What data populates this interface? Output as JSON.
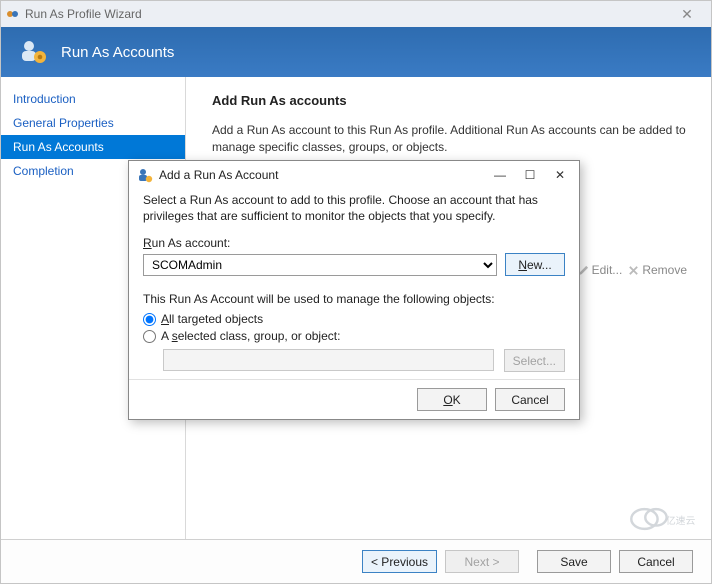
{
  "window": {
    "title": "Run As Profile Wizard"
  },
  "banner": {
    "title": "Run As Accounts"
  },
  "sidebar": {
    "items": [
      {
        "label": "Introduction"
      },
      {
        "label": "General Properties"
      },
      {
        "label": "Run As Accounts"
      },
      {
        "label": "Completion"
      }
    ]
  },
  "main": {
    "heading": "Add Run As accounts",
    "desc": "Add a Run As account to this Run As profile.  Additional Run As accounts can be added to manage specific classes, groups, or objects.",
    "actions": {
      "edit": "Edit...",
      "remove": "Remove"
    }
  },
  "modal": {
    "title": "Add a Run As Account",
    "instr": "Select a Run As account to add to this profile.  Choose an account that has privileges that are sufficient to monitor the objects that you specify.",
    "account_label": "Run As account:",
    "account_value": "SCOMAdmin",
    "new_btn": "New...",
    "used_for": "This Run As Account will be used to manage the following objects:",
    "radio_all": "All targeted objects",
    "radio_selected": "A selected class, group, or object:",
    "select_btn": "Select...",
    "ok": "OK",
    "cancel": "Cancel"
  },
  "footer": {
    "previous": "< Previous",
    "next": "Next >",
    "save": "Save",
    "cancel": "Cancel"
  },
  "watermark": "亿速云"
}
